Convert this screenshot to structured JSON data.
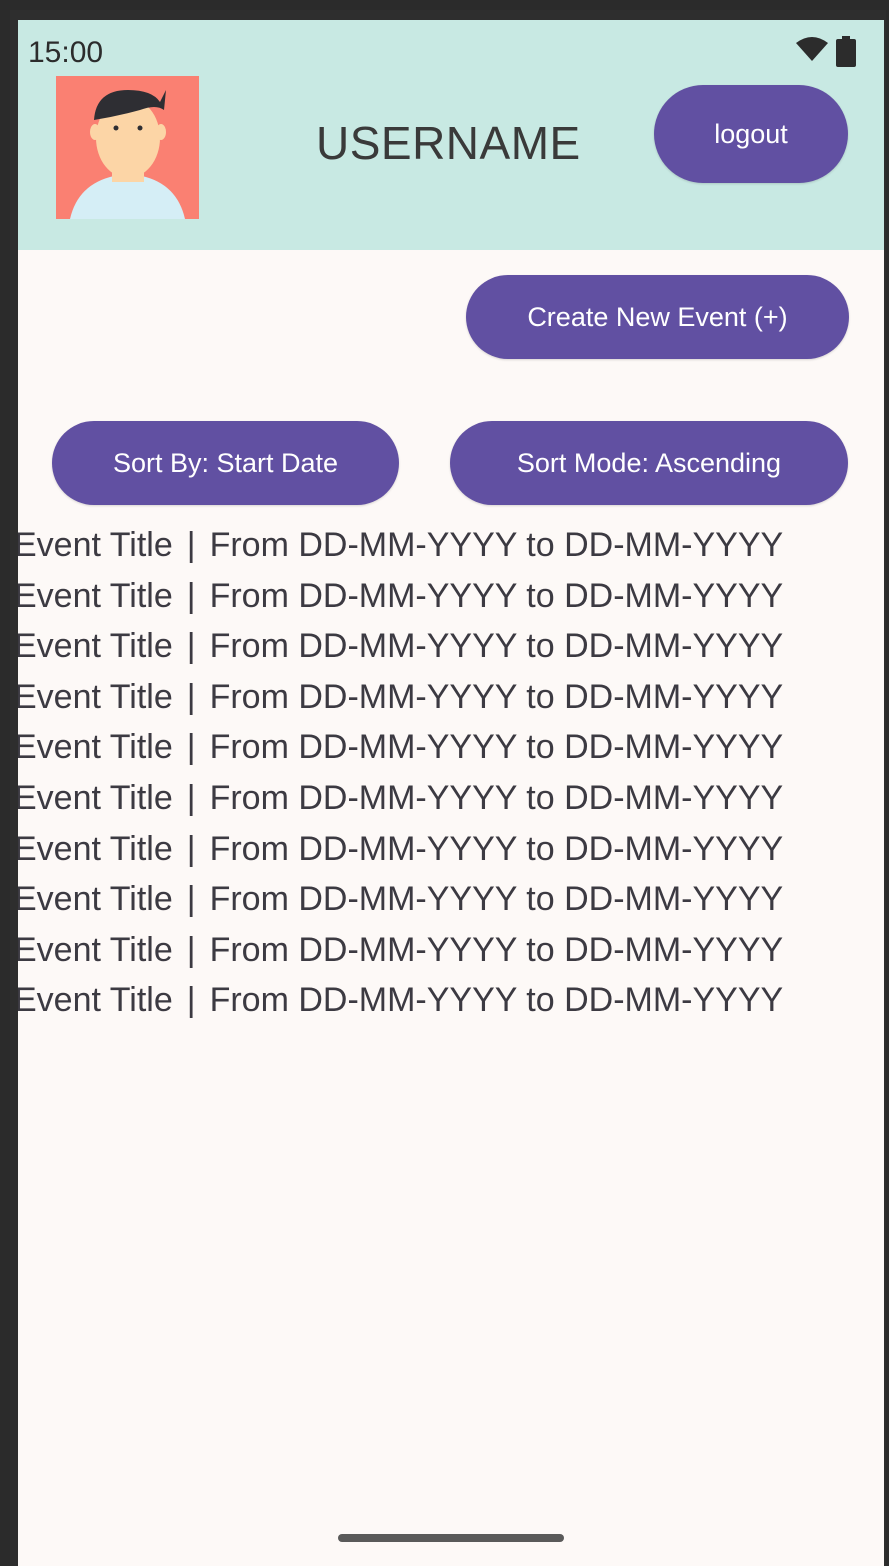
{
  "status_bar": {
    "time": "15:00",
    "icons": [
      "wifi-icon",
      "battery-icon"
    ]
  },
  "header": {
    "avatar": "avatar-icon",
    "username": "USERNAME",
    "logout_label": "logout"
  },
  "actions": {
    "create_label": "Create New Event (+)",
    "sort_by_label": "Sort By: Start Date",
    "sort_mode_label": "Sort Mode: Ascending"
  },
  "events": [
    {
      "title": "Event Title",
      "separator": "|",
      "dates": "From DD-MM-YYYY to DD-MM-YYYY"
    },
    {
      "title": "Event Title",
      "separator": "|",
      "dates": "From DD-MM-YYYY to DD-MM-YYYY"
    },
    {
      "title": "Event Title",
      "separator": "|",
      "dates": "From DD-MM-YYYY to DD-MM-YYYY"
    },
    {
      "title": "Event Title",
      "separator": "|",
      "dates": "From DD-MM-YYYY to DD-MM-YYYY"
    },
    {
      "title": "Event Title",
      "separator": "|",
      "dates": "From DD-MM-YYYY to DD-MM-YYYY"
    },
    {
      "title": "Event Title",
      "separator": "|",
      "dates": "From DD-MM-YYYY to DD-MM-YYYY"
    },
    {
      "title": "Event Title",
      "separator": "|",
      "dates": "From DD-MM-YYYY to DD-MM-YYYY"
    },
    {
      "title": "Event Title",
      "separator": "|",
      "dates": "From DD-MM-YYYY to DD-MM-YYYY"
    },
    {
      "title": "Event Title",
      "separator": "|",
      "dates": "From DD-MM-YYYY to DD-MM-YYYY"
    },
    {
      "title": "Event Title",
      "separator": "|",
      "dates": "From DD-MM-YYYY to DD-MM-YYYY"
    }
  ],
  "colors": {
    "header_bg": "#c8e9e3",
    "button_bg": "#6150a2",
    "button_text": "#ffffff",
    "page_bg": "#fdf9f7",
    "text": "#3c3a42",
    "avatar_bg": "#fa8072"
  }
}
